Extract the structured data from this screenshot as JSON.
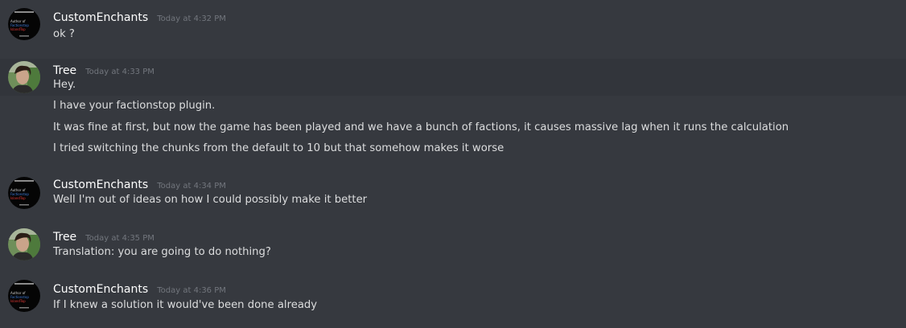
{
  "messages": [
    {
      "author": "CustomEnchants",
      "timestamp": "Today at 4:32 PM",
      "avatar_icon": "customenchants-avatar",
      "avatar_text": [
        "Author of",
        "Factionstop",
        "IslandTop"
      ],
      "lines": [
        "ok ?"
      ]
    },
    {
      "author": "Tree",
      "timestamp": "Today at 4:33 PM",
      "avatar_icon": "tree-avatar",
      "lines": [
        "Hey.",
        "I have your factionstop plugin.",
        "It was fine at first, but now the game has been played and we have a bunch of factions, it causes massive lag when it runs the calculation",
        "I tried switching the chunks from the default to 10 but that somehow makes it worse"
      ]
    },
    {
      "author": "CustomEnchants",
      "timestamp": "Today at 4:34 PM",
      "avatar_icon": "customenchants-avatar",
      "avatar_text": [
        "Author of",
        "Factionstop",
        "IslandTop"
      ],
      "lines": [
        "Well I'm out of ideas on how I could possibly make it better"
      ]
    },
    {
      "author": "Tree",
      "timestamp": "Today at 4:35 PM",
      "avatar_icon": "tree-avatar",
      "lines": [
        "Translation: you are going to do nothing?"
      ]
    },
    {
      "author": "CustomEnchants",
      "timestamp": "Today at 4:36 PM",
      "avatar_icon": "customenchants-avatar",
      "avatar_text": [
        "Author of",
        "Factionstop",
        "IslandTop"
      ],
      "lines": [
        "If I knew a solution it would've been done already"
      ]
    }
  ],
  "colors": {
    "background": "#36393f",
    "hover_background": "#32353b",
    "username": "#ffffff",
    "timestamp": "#72767d",
    "message_text": "#dcddde"
  }
}
